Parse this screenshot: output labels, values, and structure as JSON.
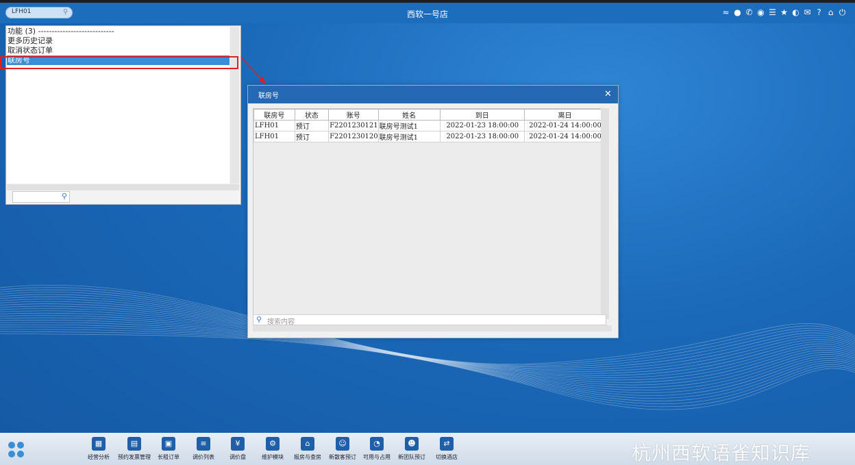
{
  "topbar": {
    "search_value": "LFH01",
    "title": "西软一号店",
    "icons": [
      "wifi-icon",
      "message-icon",
      "phone-icon",
      "palette-icon",
      "menu-icon",
      "star-icon",
      "contrast-icon",
      "mail-icon",
      "help-icon",
      "home-icon",
      "power-icon"
    ]
  },
  "panel": {
    "items": [
      "功能 (3) ----------------------------",
      "更多历史记录",
      "取消状态订单",
      "联房号"
    ],
    "selected_index": 3
  },
  "dialog": {
    "title": "联房号",
    "columns": [
      "联房号",
      "状态",
      "账号",
      "姓名",
      "到日",
      "离日"
    ],
    "rows": [
      [
        "LFH01",
        "预订",
        "F2201230121",
        "联房号测试1",
        "2022-01-23 18:00:00",
        "2022-01-24 14:00:00"
      ],
      [
        "LFH01",
        "预订",
        "F2201230120",
        "联房号测试1",
        "2022-01-23 18:00:00",
        "2022-01-24 14:00:00"
      ]
    ],
    "search_placeholder": "搜索内容"
  },
  "taskbar": {
    "buttons": [
      {
        "label": "经营分析",
        "icon": "bar-chart-icon"
      },
      {
        "label": "预约发票管理",
        "icon": "invoice-icon"
      },
      {
        "label": "长租订单",
        "icon": "briefcase-icon"
      },
      {
        "label": "调价列表",
        "icon": "list-icon"
      },
      {
        "label": "调价盘",
        "icon": "price-icon"
      },
      {
        "label": "维护模块",
        "icon": "wrench-icon"
      },
      {
        "label": "报房与查房",
        "icon": "house-icon"
      },
      {
        "label": "新散客预订",
        "icon": "guest-icon"
      },
      {
        "label": "可用与占用",
        "icon": "pie-icon"
      },
      {
        "label": "新团队预订",
        "icon": "group-icon"
      },
      {
        "label": "切换酒店",
        "icon": "switch-icon"
      }
    ]
  },
  "watermark": "杭州西软语雀知识库",
  "colors": {
    "accent": "#2569b4",
    "selection": "#3a8ed6",
    "highlight_box": "#e02020"
  }
}
